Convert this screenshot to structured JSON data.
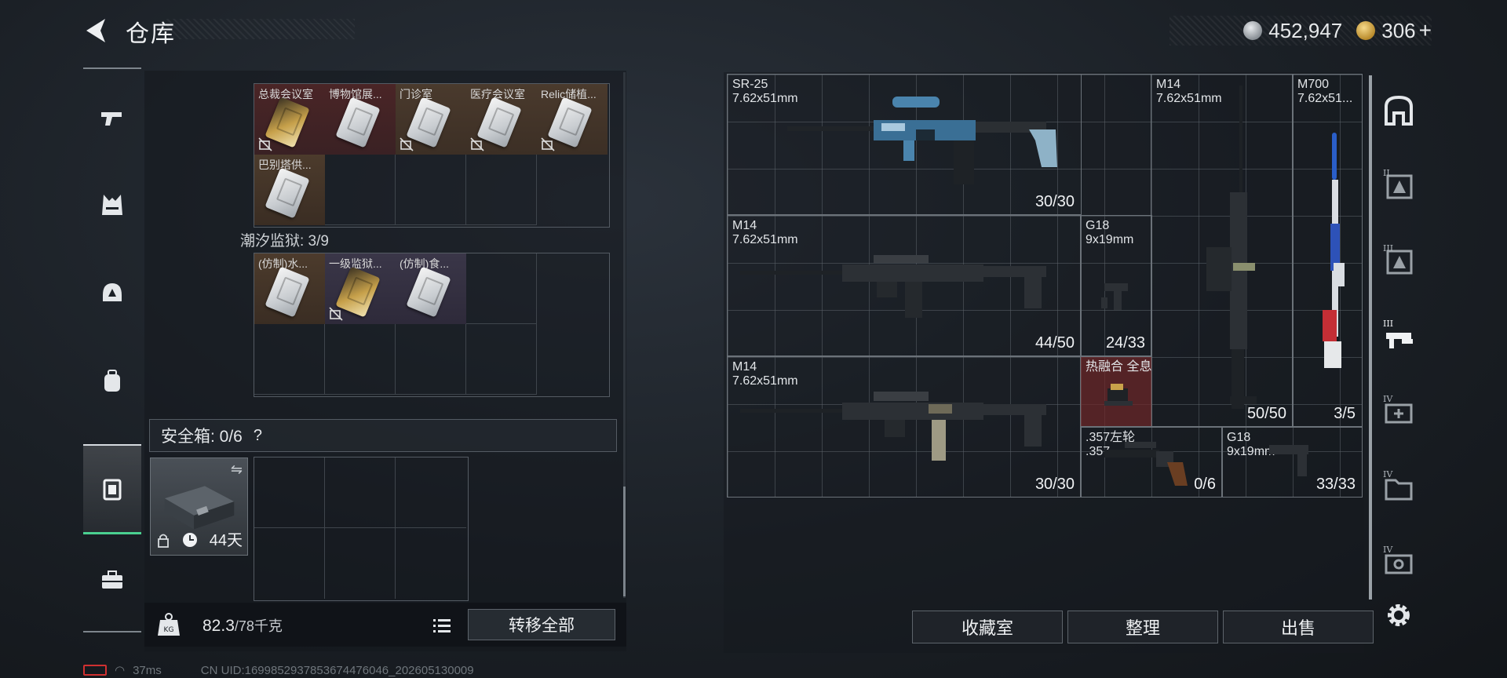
{
  "header": {
    "title": "仓库",
    "currency_silver": "452,947",
    "currency_gold": "306",
    "currency_add": "+"
  },
  "left_nav": {
    "items": [
      {
        "icon": "pistol-icon"
      },
      {
        "icon": "vest-icon"
      },
      {
        "icon": "helmet-icon"
      },
      {
        "icon": "backpack-icon"
      },
      {
        "icon": "safe-box-icon",
        "active": true
      },
      {
        "icon": "toolbox-icon"
      }
    ]
  },
  "storage": {
    "section_one_cards": [
      {
        "label": "总裁会议室",
        "color": "red",
        "card": "gold",
        "locked": true
      },
      {
        "label": "博物馆展...",
        "color": "red",
        "card": "white",
        "locked": false
      },
      {
        "label": "门诊室",
        "color": "brown",
        "card": "white",
        "locked": true
      },
      {
        "label": "医疗会议室",
        "color": "brown",
        "card": "white",
        "locked": true
      },
      {
        "label": "Relic储植...",
        "color": "brown",
        "card": "white",
        "locked": true
      },
      {
        "label": "巴别塔供...",
        "color": "tan",
        "card": "white",
        "locked": false
      }
    ],
    "section_two_title": "潮汐监狱: 3/9",
    "section_two_cards": [
      {
        "label": "(仿制)水...",
        "color": "tan",
        "card": "white",
        "locked": false
      },
      {
        "label": "一级监狱...",
        "color": "purple",
        "card": "gold",
        "locked": true
      },
      {
        "label": "(仿制)食...",
        "color": "purple",
        "card": "white",
        "locked": false
      }
    ],
    "safe_box_label": "安全箱: 0/6",
    "safe_box_help": "?",
    "safe_box_days": "44天",
    "weight_value": "82.3",
    "weight_capacity": "/78千克",
    "transfer_all": "转移全部"
  },
  "weapons": [
    {
      "name": "SR-25",
      "caliber": "7.62x51mm",
      "ammo": "30/30"
    },
    {
      "name": "M14",
      "caliber": "7.62x51mm",
      "ammo": "50/50"
    },
    {
      "name": "M700",
      "caliber": "7.62x51...",
      "ammo": "3/5"
    },
    {
      "name": "M14",
      "caliber": "7.62x51mm",
      "ammo": "44/50"
    },
    {
      "name": "G18",
      "caliber": "9x19mm",
      "ammo": "24/33"
    },
    {
      "name": "M14",
      "caliber": "7.62x51mm",
      "ammo": "30/30"
    },
    {
      "name": "热融合 全息",
      "caliber": "",
      "ammo": ""
    },
    {
      "name": ".357左轮",
      "caliber": ".357",
      "ammo": "0/6"
    },
    {
      "name": "G18",
      "caliber": "9x19mm",
      "ammo": "33/33"
    }
  ],
  "actions": {
    "collection": "收藏室",
    "sort": "整理",
    "sell": "出售"
  },
  "right_nav": {
    "items": [
      {
        "icon": "armory-icon",
        "tag": ""
      },
      {
        "icon": "level-ii-storage-icon",
        "tag": "II"
      },
      {
        "icon": "level-iii-storage-icon",
        "tag": "III"
      },
      {
        "icon": "level-iii-workbench-icon",
        "tag": "III"
      },
      {
        "icon": "level-iv-add-icon",
        "tag": "IV"
      },
      {
        "icon": "level-iv-folder-icon",
        "tag": "IV"
      },
      {
        "icon": "level-iv-gear-icon",
        "tag": "IV"
      },
      {
        "icon": "settings-icon",
        "tag": ""
      }
    ]
  },
  "status": {
    "ping": "37ms",
    "uid": "CN UID:1699852937853674476046_202605130009"
  },
  "colors": {
    "accent_green": "#4ad090",
    "card_red": "#4a2526",
    "card_brown": "#4a3a2d",
    "card_purple": "#3a3648",
    "battery_red": "#d03030"
  }
}
